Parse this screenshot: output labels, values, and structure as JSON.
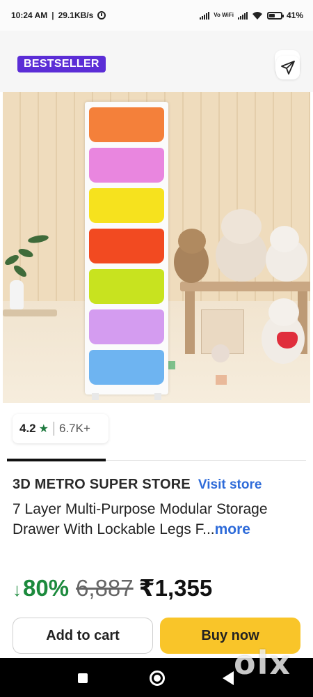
{
  "status_bar": {
    "time": "10:24 AM",
    "separator": "|",
    "net_speed": "29.1KB/s",
    "vowifi": "Vo WiFi",
    "battery": "41%"
  },
  "product": {
    "badge": "BESTSELLER",
    "wishlist_icon": "heart-icon",
    "share_icon": "share-arrow-icon",
    "rating": "4.2",
    "rating_star": "★",
    "rating_count": "6.7K+",
    "store_name": "3D METRO SUPER STORE",
    "visit_store": "Visit store",
    "title": "7 Layer Multi-Purpose Modular Storage Drawer With Lockable Legs F...",
    "more": "more",
    "discount_arrow": "↓",
    "discount": "80%",
    "mrp": "6,887",
    "price": "₹1,355"
  },
  "actions": {
    "add_to_cart": "Add to cart",
    "buy_now": "Buy now"
  },
  "watermark": "olx",
  "colors": {
    "badge": "#5b2dd6",
    "heart": "#e53935",
    "link": "#2e6bd9",
    "discount": "#1c8a3d",
    "buy_now": "#f9c529",
    "drawers": [
      "#f4803a",
      "#e986df",
      "#f6e21e",
      "#f24a21",
      "#c8e31f",
      "#d49cf0",
      "#6eb4f1"
    ]
  }
}
